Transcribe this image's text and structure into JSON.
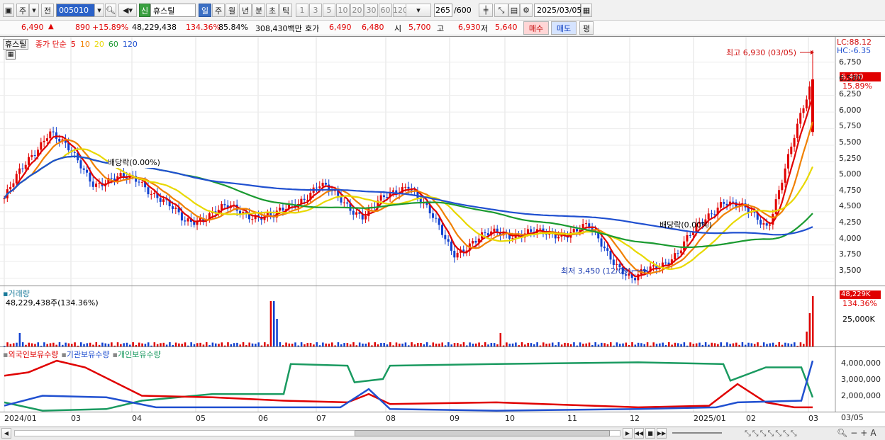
{
  "toolbar": {
    "market_btn": "주",
    "prev_btn": "전",
    "code": "005010",
    "name": "휴스틸",
    "new_badge": "신",
    "periods": [
      "일",
      "주",
      "월",
      "년",
      "분",
      "초",
      "틱"
    ],
    "intervals": [
      "1",
      "3",
      "5",
      "10",
      "20",
      "30",
      "60",
      "120"
    ],
    "count": "265",
    "count_max": "/600",
    "date": "2025/03/05"
  },
  "quote": {
    "price": "6,490",
    "change": "890",
    "change_pct": "+15.89%",
    "volume": "48,229,438",
    "vol_ratio": "134.36%",
    "turnover": "85.84%",
    "amount": "308,430백만",
    "hoga_label": "호가",
    "hoga1": "6,490",
    "hoga2": "6,480",
    "open_label": "시",
    "open": "5,700",
    "high_label": "고",
    "high": "6,930",
    "low_label": "저",
    "low": "5,640",
    "buy_btn": "매수",
    "sell_btn": "매도",
    "avg_btn": "평"
  },
  "price_panel": {
    "stock_tag": "휴스틸",
    "legend": [
      {
        "label": "종가 단순",
        "color": "#e00000"
      },
      {
        "label": "5",
        "color": "#e00000"
      },
      {
        "label": "10",
        "color": "#f08000"
      },
      {
        "label": "20",
        "color": "#e8d800"
      },
      {
        "label": "60",
        "color": "#1a9a30"
      },
      {
        "label": "120",
        "color": "#2050d0"
      }
    ],
    "lc": "LC:88.12",
    "hc": "HC:-6.35",
    "y_ticks": [
      "6,750",
      "6,500",
      "6,250",
      "6,000",
      "5,750",
      "5,500",
      "5,250",
      "5,000",
      "4,750",
      "4,500",
      "4,250",
      "4,000",
      "3,750",
      "3,500"
    ],
    "last_price": "6,490",
    "last_pct": "15.89%",
    "max_note": "최고 6,930 (03/05)",
    "min_note": "최저 3,450 (12/09)",
    "div_note1": "배당락(0.00%)",
    "div_note2": "배당락(0.00%)"
  },
  "volume_panel": {
    "title": "거래량",
    "info": "48,229,438주(134.36%)",
    "last": "48,229K",
    "last_pct": "134.36%",
    "tick": "25,000K"
  },
  "holding_panel": {
    "legend": [
      {
        "label": "외국인보유수량",
        "color": "#e00000"
      },
      {
        "label": "기관보유수량",
        "color": "#2050d0"
      },
      {
        "label": "개인보유수량",
        "color": "#1a9a60"
      }
    ],
    "y_ticks": [
      "4,000,000",
      "3,000,000",
      "2,000,000"
    ]
  },
  "x_axis": [
    "2024/01",
    "03",
    "04",
    "05",
    "06",
    "07",
    "08",
    "09",
    "10",
    "11",
    "12",
    "2025/01",
    "02",
    "03"
  ],
  "x_axis_right": "03/05",
  "chart_data": {
    "type": "candlestick",
    "title": "휴스틸",
    "ylim": [
      3400,
      6950
    ],
    "key_points": [
      {
        "x": "2024/01",
        "close": 4700
      },
      {
        "x": "2024/01 mid",
        "close": 5750
      },
      {
        "x": "2024/02",
        "close": 4950
      },
      {
        "x": "2024/03",
        "close": 5000
      },
      {
        "x": "2024/04",
        "close": 4350
      },
      {
        "x": "2024/05",
        "close": 4550
      },
      {
        "x": "2024/06",
        "close": 4400
      },
      {
        "x": "2024/06 spike",
        "close": 4900
      },
      {
        "x": "2024/07",
        "close": 4450
      },
      {
        "x": "2024/07 end",
        "close": 4950
      },
      {
        "x": "2024/08",
        "close": 3900
      },
      {
        "x": "2024/09",
        "close": 4200
      },
      {
        "x": "2024/10",
        "close": 4150
      },
      {
        "x": "2024/11",
        "close": 4250
      },
      {
        "x": "2024/12/09",
        "close": 3450
      },
      {
        "x": "2025/01",
        "close": 3900
      },
      {
        "x": "2025/01 end",
        "close": 4700
      },
      {
        "x": "2025/02",
        "close": 4300
      },
      {
        "x": "2025/03/05",
        "close": 6490
      }
    ],
    "max": {
      "date": "03/05",
      "value": 6930
    },
    "min": {
      "date": "12/09",
      "value": 3450
    }
  }
}
